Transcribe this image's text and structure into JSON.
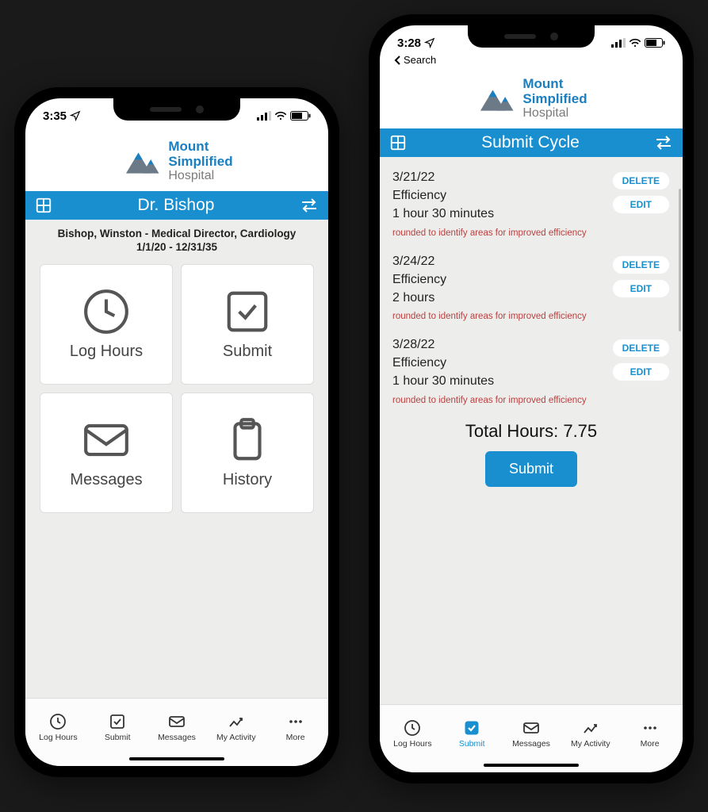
{
  "brand": {
    "line1": "Mount",
    "line2": "Simplified",
    "line3": "Hospital"
  },
  "phone1": {
    "status_time": "3:35",
    "title": "Dr. Bishop",
    "subheader": "Bishop, Winston - Medical Director, Cardiology",
    "daterange": "1/1/20 - 12/31/35",
    "tiles": {
      "log_hours": "Log Hours",
      "submit": "Submit",
      "messages": "Messages",
      "history": "History"
    },
    "tabs": {
      "log_hours": "Log Hours",
      "submit": "Submit",
      "messages": "Messages",
      "my_activity": "My Activity",
      "more": "More"
    }
  },
  "phone2": {
    "status_time": "3:28",
    "back_label": "Search",
    "title": "Submit Cycle",
    "entries": [
      {
        "date": "3/21/22",
        "category": "Efficiency",
        "duration": "1 hour 30 minutes",
        "note": "rounded to identify areas for improved efficiency"
      },
      {
        "date": "3/24/22",
        "category": "Efficiency",
        "duration": "2 hours",
        "note": "rounded to identify areas for improved efficiency"
      },
      {
        "date": "3/28/22",
        "category": "Efficiency",
        "duration": "1 hour 30 minutes",
        "note": "rounded to identify areas for improved efficiency"
      }
    ],
    "buttons": {
      "delete": "DELETE",
      "edit": "EDIT"
    },
    "total_label": "Total Hours: 7.75",
    "submit_label": "Submit",
    "tabs": {
      "log_hours": "Log Hours",
      "submit": "Submit",
      "messages": "Messages",
      "my_activity": "My Activity",
      "more": "More"
    }
  }
}
